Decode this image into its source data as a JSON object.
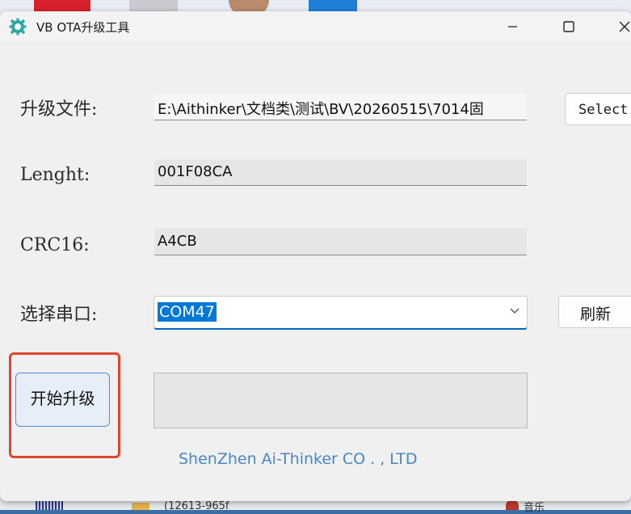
{
  "window": {
    "title": "VB OTA升级工具"
  },
  "form": {
    "file_label": "升级文件:",
    "file_value": "E:\\Aithinker\\文档类\\测试\\BV\\20260515\\7014固",
    "select_button": "Select",
    "length_label": "Lenght:",
    "length_value": "001F08CA",
    "crc_label": "CRC16:",
    "crc_value": "A4CB",
    "port_label": "选择串口:",
    "port_value": "COM47",
    "refresh_button": "刷新",
    "start_button": "开始升级",
    "progress": 0
  },
  "footer": {
    "company": "ShenZhen Ai-Thinker CO . , LTD"
  },
  "desktop": {
    "bottom_item_1": "(12613-965f",
    "bottom_item_2": "音乐"
  },
  "colors": {
    "accent": "#0078d7",
    "highlight_border": "#e0462e",
    "footer_text": "#4a86c4"
  }
}
